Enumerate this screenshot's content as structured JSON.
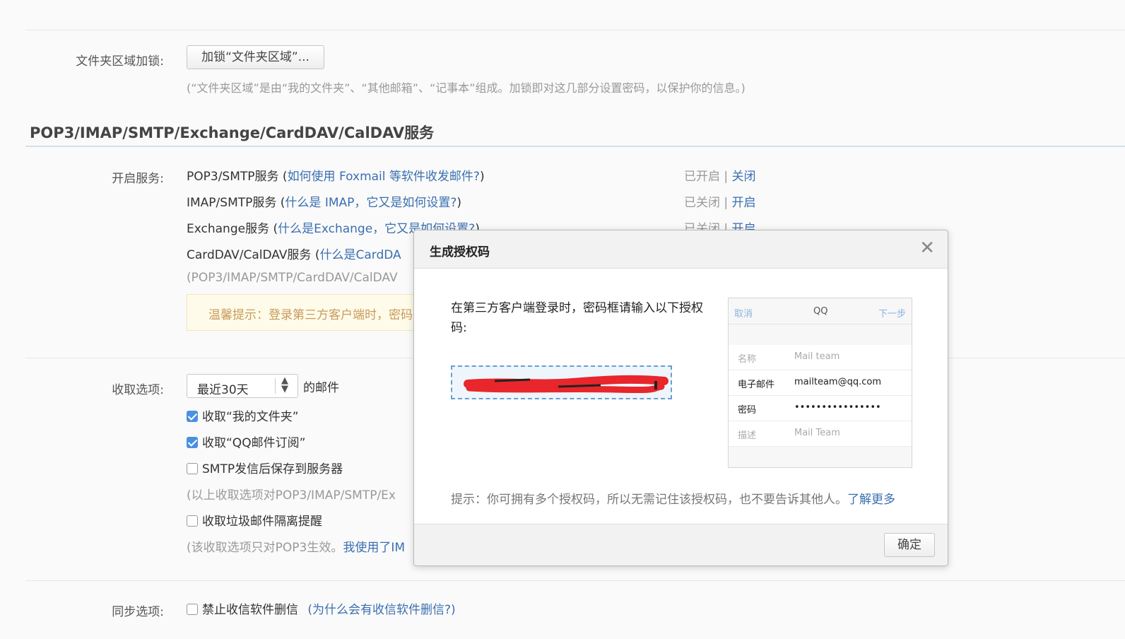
{
  "folder_lock": {
    "label": "文件夹区域加锁:",
    "button": "加锁“文件夹区域”...",
    "note": "(“文件夹区域”是由“我的文件夹”、“其他邮箱”、“记事本”组成。加锁即对这几部分设置密码，以保护你的信息。)"
  },
  "section_title": "POP3/IMAP/SMTP/Exchange/CardDAV/CalDAV服务",
  "services": {
    "label": "开启服务:",
    "items": [
      {
        "name": "POP3/SMTP服务 (",
        "help": "如何使用 Foxmail 等软件收发邮件?",
        "close": ")",
        "status": "已开启 |",
        "action": "关闭"
      },
      {
        "name": "IMAP/SMTP服务 (",
        "help": "什么是 IMAP，它又是如何设置?",
        "close": ")",
        "status": "已关闭 |",
        "action": "开启"
      },
      {
        "name": "Exchange服务 (",
        "help": "什么是Exchange，它又是如何设置?",
        "close": ")",
        "status": "已关闭 |",
        "action": "开启"
      },
      {
        "name": "CardDAV/CalDAV服务 (",
        "help": "什么是CardDA"
      }
    ],
    "note": "(POP3/IMAP/SMTP/CardDAV/CalDAV",
    "warm_tip": "温馨提示：登录第三方客户端时，密码"
  },
  "receive": {
    "label": "收取选项:",
    "select_value": "最近30天",
    "suffix": "的邮件",
    "opt1": "收取“我的文件夹”",
    "opt2": "收取“QQ邮件订阅”",
    "opt3": "SMTP发信后保存到服务器",
    "note1": "(以上收取选项对POP3/IMAP/SMTP/Ex",
    "opt4": "收取垃圾邮件隔离提醒",
    "note2_a": "(该收取选项只对POP3生效。",
    "note2_b": "我使用了IM"
  },
  "sync": {
    "label": "同步选项:",
    "opt1": "禁止收信软件删信",
    "help": "(为什么会有收信软件删信?)"
  },
  "modal": {
    "title": "生成授权码",
    "close_glyph": "✕",
    "text": "在第三方客户端登录时，密码框请输入以下授权码:",
    "preview": {
      "cancel": "取消",
      "center": "QQ",
      "next": "下一步",
      "rows": [
        {
          "k": "名称",
          "v": "Mail team"
        },
        {
          "k": "电子邮件",
          "v": "mailteam@qq.com"
        },
        {
          "k": "密码",
          "v": "••••••••••••••••"
        },
        {
          "k": "描述",
          "v": "Mail Team"
        }
      ]
    },
    "tip": "提示：你可拥有多个授权码，所以无需记住该授权码，也不要告诉其他人。",
    "learn_more": "了解更多",
    "confirm": "确定"
  },
  "colors": {
    "link": "#3a6fb0",
    "redaction": "#e8262b",
    "tip_text": "#c89a5a"
  }
}
